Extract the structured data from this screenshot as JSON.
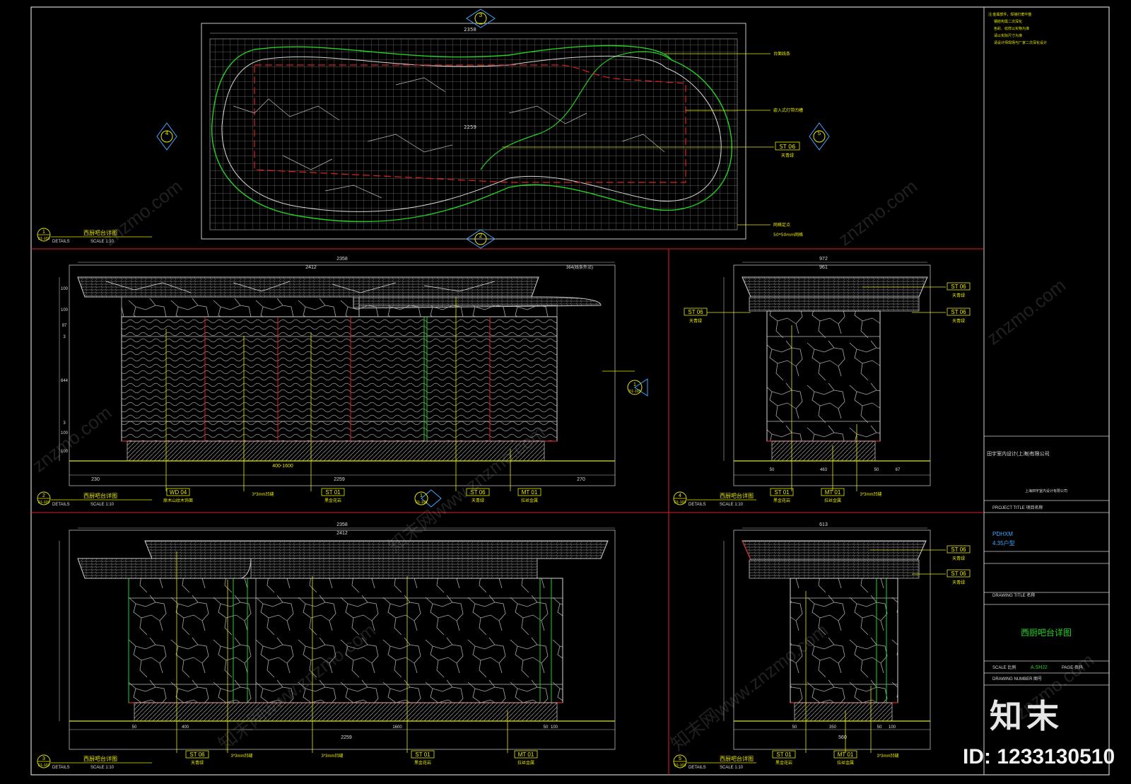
{
  "colors": {
    "bg": "#000000",
    "frame": "#d0d0d0",
    "red": "#e02020",
    "green": "#22d322",
    "yellow": "#e8e800",
    "cyan": "#3fa9ff",
    "grey": "#8a8a8a"
  },
  "notes": [
    "注:金属部件，焊接打磨平整",
    "钢结构需二次深化",
    "色彩、纹样以实物为准",
    "请以实际尺寸为准",
    "请设计师现场与厂家二次深化设计"
  ],
  "title_block": {
    "company": "田宇室内设计(上海)有限公司",
    "company_sub": "上海田宇室内设计有限公司",
    "project_label": "PROJECT TITLE 项目名称",
    "project_name": "PDHXM",
    "project_sub": "4.35户型",
    "drawing_label": "DRAWING TITLE 名称",
    "drawing_title": "西厨吧台详图",
    "scale_label": "SCALE 比例",
    "scale_value": "A.SHJ2",
    "page_label": "PAGE 页码",
    "drawing_number_label": "DRAWING NUMBER 图号"
  },
  "views": [
    {
      "num": "1",
      "ref": "D1-103",
      "title": "西厨吧台详图",
      "details": "DETAILS",
      "scale": "SCALE 1:10"
    },
    {
      "num": "2",
      "ref": "D1-103",
      "title": "西厨吧台详图",
      "details": "DETAILS",
      "scale": "SCALE 1:10"
    },
    {
      "num": "3",
      "ref": "D1-103",
      "title": "西厨吧台详图",
      "details": "DETAILS",
      "scale": "SCALE 1:10"
    },
    {
      "num": "4",
      "ref": "D1-103",
      "title": "西厨吧台详图",
      "details": "DETAILS",
      "scale": "SCALE 1:10"
    },
    {
      "num": "5",
      "ref": "D1-103",
      "title": "西厨吧台详图",
      "details": "DETAILS",
      "scale": "SCALE 1:10"
    }
  ],
  "plan": {
    "dim_top": "2358",
    "dim_mid": "2259",
    "leader_labels": [
      "台面线条",
      "嵌入式灯带凹槽",
      "网格定点"
    ],
    "grid_label": "50*50mm网格",
    "material_code": "ST 06",
    "material_name": "天青绿",
    "section_marks": [
      "3",
      "2",
      "4",
      "5"
    ]
  },
  "elev_a": {
    "dim_total": "2358",
    "dim_2412": "2412",
    "dim_364": "364(线条外沿)",
    "dims_bottom": [
      "230",
      "2259",
      "270"
    ],
    "dim_inner": "400-1600",
    "dims_side": [
      "100",
      "100",
      "97",
      "3",
      "644",
      "3",
      "100",
      "100"
    ],
    "labels": [
      {
        "code": "WD 04",
        "name": "原木山纹木饰面"
      },
      {
        "code": "",
        "name": "3*3mm凹缝"
      },
      {
        "code": "ST 01",
        "name": "黑金花岩"
      },
      {
        "code": "ST 06",
        "name": "天青绿"
      },
      {
        "code": "MT 01",
        "name": "拉丝金属"
      }
    ]
  },
  "elev_b": {
    "dim_total": "2358",
    "dim_2412": "2412",
    "dims_bottom": [
      "50",
      "400",
      "1600",
      "50",
      "100"
    ],
    "dim_2259": "2259",
    "labels": [
      {
        "code": "ST 06",
        "name": "天青绿"
      },
      {
        "code": "",
        "name": "3*3mm凹缝"
      },
      {
        "code": "",
        "name": "3*3mm凹缝"
      },
      {
        "code": "ST 01",
        "name": "黑金花岩"
      },
      {
        "code": "MT 01",
        "name": "拉丝金属"
      }
    ]
  },
  "elev_c": {
    "dim_total": "972",
    "dim_961": "961",
    "dims_bottom": [
      "50",
      "463",
      "50",
      "67"
    ],
    "labels": [
      {
        "code": "ST 06",
        "name": "天青绿"
      },
      {
        "code": "ST 06",
        "name": "天青绿"
      },
      {
        "code": "ST 06",
        "name": "天青绿"
      },
      {
        "code": "ST 01",
        "name": "黑金花岩"
      },
      {
        "code": "MT 01",
        "name": "拉丝金属"
      },
      {
        "code": "",
        "name": "3*3mm凹缝"
      }
    ]
  },
  "elev_d": {
    "dim_total": "613",
    "dims_bottom": [
      "50",
      "350",
      "50",
      "100"
    ],
    "dim_560": "560",
    "labels": [
      {
        "code": "ST 06",
        "name": "天青绿"
      },
      {
        "code": "ST 06",
        "name": "天青绿"
      },
      {
        "code": "ST 01",
        "name": "黑金花岩"
      },
      {
        "code": "MT 01",
        "name": "拉丝金属"
      },
      {
        "code": "",
        "name": "3*3mm凹缝"
      }
    ]
  },
  "watermark": "znzmo.com",
  "watermark_cn": "知末网www.znzmo.com",
  "brand": {
    "logo": "知末",
    "id": "ID: 1233130510"
  }
}
